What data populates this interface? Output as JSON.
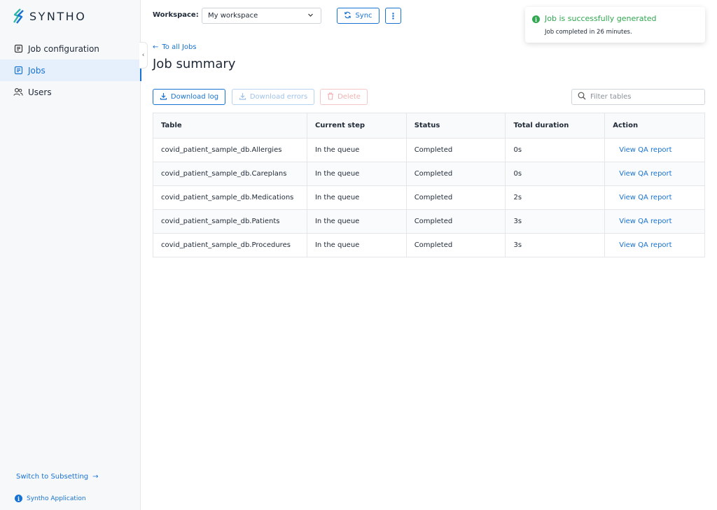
{
  "brand": {
    "name": "SYNTHO",
    "accent": "#1872d2",
    "success": "#2fa84f"
  },
  "sidebar": {
    "items": [
      {
        "label": "Job configuration",
        "icon": "document-icon",
        "active": false
      },
      {
        "label": "Jobs",
        "icon": "list-icon",
        "active": true
      },
      {
        "label": "Users",
        "icon": "users-icon",
        "active": false
      }
    ],
    "switch_label": "Switch to Subsetting",
    "app_label": "Syntho Application"
  },
  "topbar": {
    "workspace_label": "Workspace:",
    "workspace_value": "My workspace",
    "sync_label": "Sync"
  },
  "toast": {
    "title": "Job is successfully generated",
    "message": "Job completed in 26 minutes."
  },
  "main": {
    "back_label": "To all Jobs",
    "title": "Job summary",
    "download_log_label": "Download log",
    "download_errors_label": "Download errors",
    "delete_label": "Delete",
    "filter_placeholder": "Filter tables"
  },
  "table": {
    "headers": [
      "Table",
      "Current step",
      "Status",
      "Total duration",
      "Action"
    ],
    "rows": [
      {
        "table": "covid_patient_sample_db.Allergies",
        "step": "In the queue",
        "status": "Completed",
        "duration": "0s",
        "action": "View QA report"
      },
      {
        "table": "covid_patient_sample_db.Careplans",
        "step": "In the queue",
        "status": "Completed",
        "duration": "0s",
        "action": "View QA report"
      },
      {
        "table": "covid_patient_sample_db.Medications",
        "step": "In the queue",
        "status": "Completed",
        "duration": "2s",
        "action": "View QA report"
      },
      {
        "table": "covid_patient_sample_db.Patients",
        "step": "In the queue",
        "status": "Completed",
        "duration": "3s",
        "action": "View QA report"
      },
      {
        "table": "covid_patient_sample_db.Procedures",
        "step": "In the queue",
        "status": "Completed",
        "duration": "3s",
        "action": "View QA report"
      }
    ]
  }
}
